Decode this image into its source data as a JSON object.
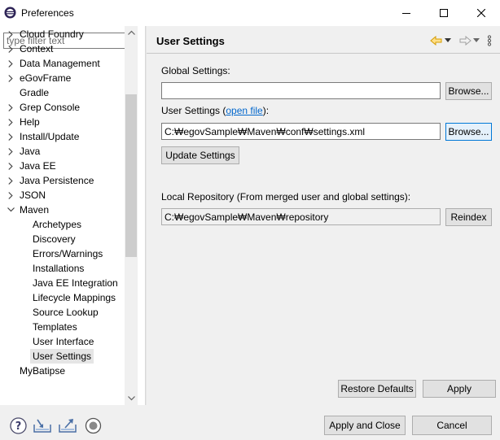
{
  "window": {
    "title": "Preferences",
    "icon": "eclipse-icon"
  },
  "filter": {
    "placeholder": "type filter text",
    "value": ""
  },
  "tree": {
    "items": [
      {
        "label": "Cloud Foundry",
        "expandable": true,
        "expanded": false,
        "level": 0
      },
      {
        "label": "Context",
        "expandable": true,
        "expanded": false,
        "level": 0
      },
      {
        "label": "Data Management",
        "expandable": true,
        "expanded": false,
        "level": 0
      },
      {
        "label": "eGovFrame",
        "expandable": true,
        "expanded": false,
        "level": 0
      },
      {
        "label": "Gradle",
        "expandable": false,
        "expanded": false,
        "level": 0
      },
      {
        "label": "Grep Console",
        "expandable": true,
        "expanded": false,
        "level": 0
      },
      {
        "label": "Help",
        "expandable": true,
        "expanded": false,
        "level": 0
      },
      {
        "label": "Install/Update",
        "expandable": true,
        "expanded": false,
        "level": 0
      },
      {
        "label": "Java",
        "expandable": true,
        "expanded": false,
        "level": 0
      },
      {
        "label": "Java EE",
        "expandable": true,
        "expanded": false,
        "level": 0
      },
      {
        "label": "Java Persistence",
        "expandable": true,
        "expanded": false,
        "level": 0
      },
      {
        "label": "JSON",
        "expandable": true,
        "expanded": false,
        "level": 0
      },
      {
        "label": "Maven",
        "expandable": true,
        "expanded": true,
        "level": 0
      },
      {
        "label": "Archetypes",
        "expandable": false,
        "level": 1
      },
      {
        "label": "Discovery",
        "expandable": false,
        "level": 1
      },
      {
        "label": "Errors/Warnings",
        "expandable": false,
        "level": 1
      },
      {
        "label": "Installations",
        "expandable": false,
        "level": 1
      },
      {
        "label": "Java EE Integration",
        "expandable": false,
        "level": 1
      },
      {
        "label": "Lifecycle Mappings",
        "expandable": false,
        "level": 1
      },
      {
        "label": "Source Lookup",
        "expandable": false,
        "level": 1
      },
      {
        "label": "Templates",
        "expandable": false,
        "level": 1
      },
      {
        "label": "User Interface",
        "expandable": false,
        "level": 1
      },
      {
        "label": "User Settings",
        "expandable": false,
        "level": 1,
        "selected": true
      },
      {
        "label": "MyBatipse",
        "expandable": false,
        "level": 0
      }
    ]
  },
  "page": {
    "title": "User Settings",
    "global_settings_label": "Global Settings:",
    "global_settings_value": "",
    "user_settings_label_prefix": "User Settings (",
    "open_file_link": "open file",
    "user_settings_label_suffix": "):",
    "user_settings_value": "C:₩egovSample₩Maven₩conf₩settings.xml",
    "browse_label": "Browse...",
    "update_settings_label": "Update Settings",
    "local_repo_label": "Local Repository (From merged user and global settings):",
    "local_repo_value": "C:₩egovSample₩Maven₩repository",
    "reindex_label": "Reindex",
    "restore_defaults_label": "Restore Defaults",
    "apply_label": "Apply"
  },
  "footer": {
    "apply_and_close_label": "Apply and Close",
    "cancel_label": "Cancel"
  },
  "colors": {
    "link": "#0066cc",
    "focus_border": "#0078d7",
    "nav_arrow": "#e0a000"
  }
}
